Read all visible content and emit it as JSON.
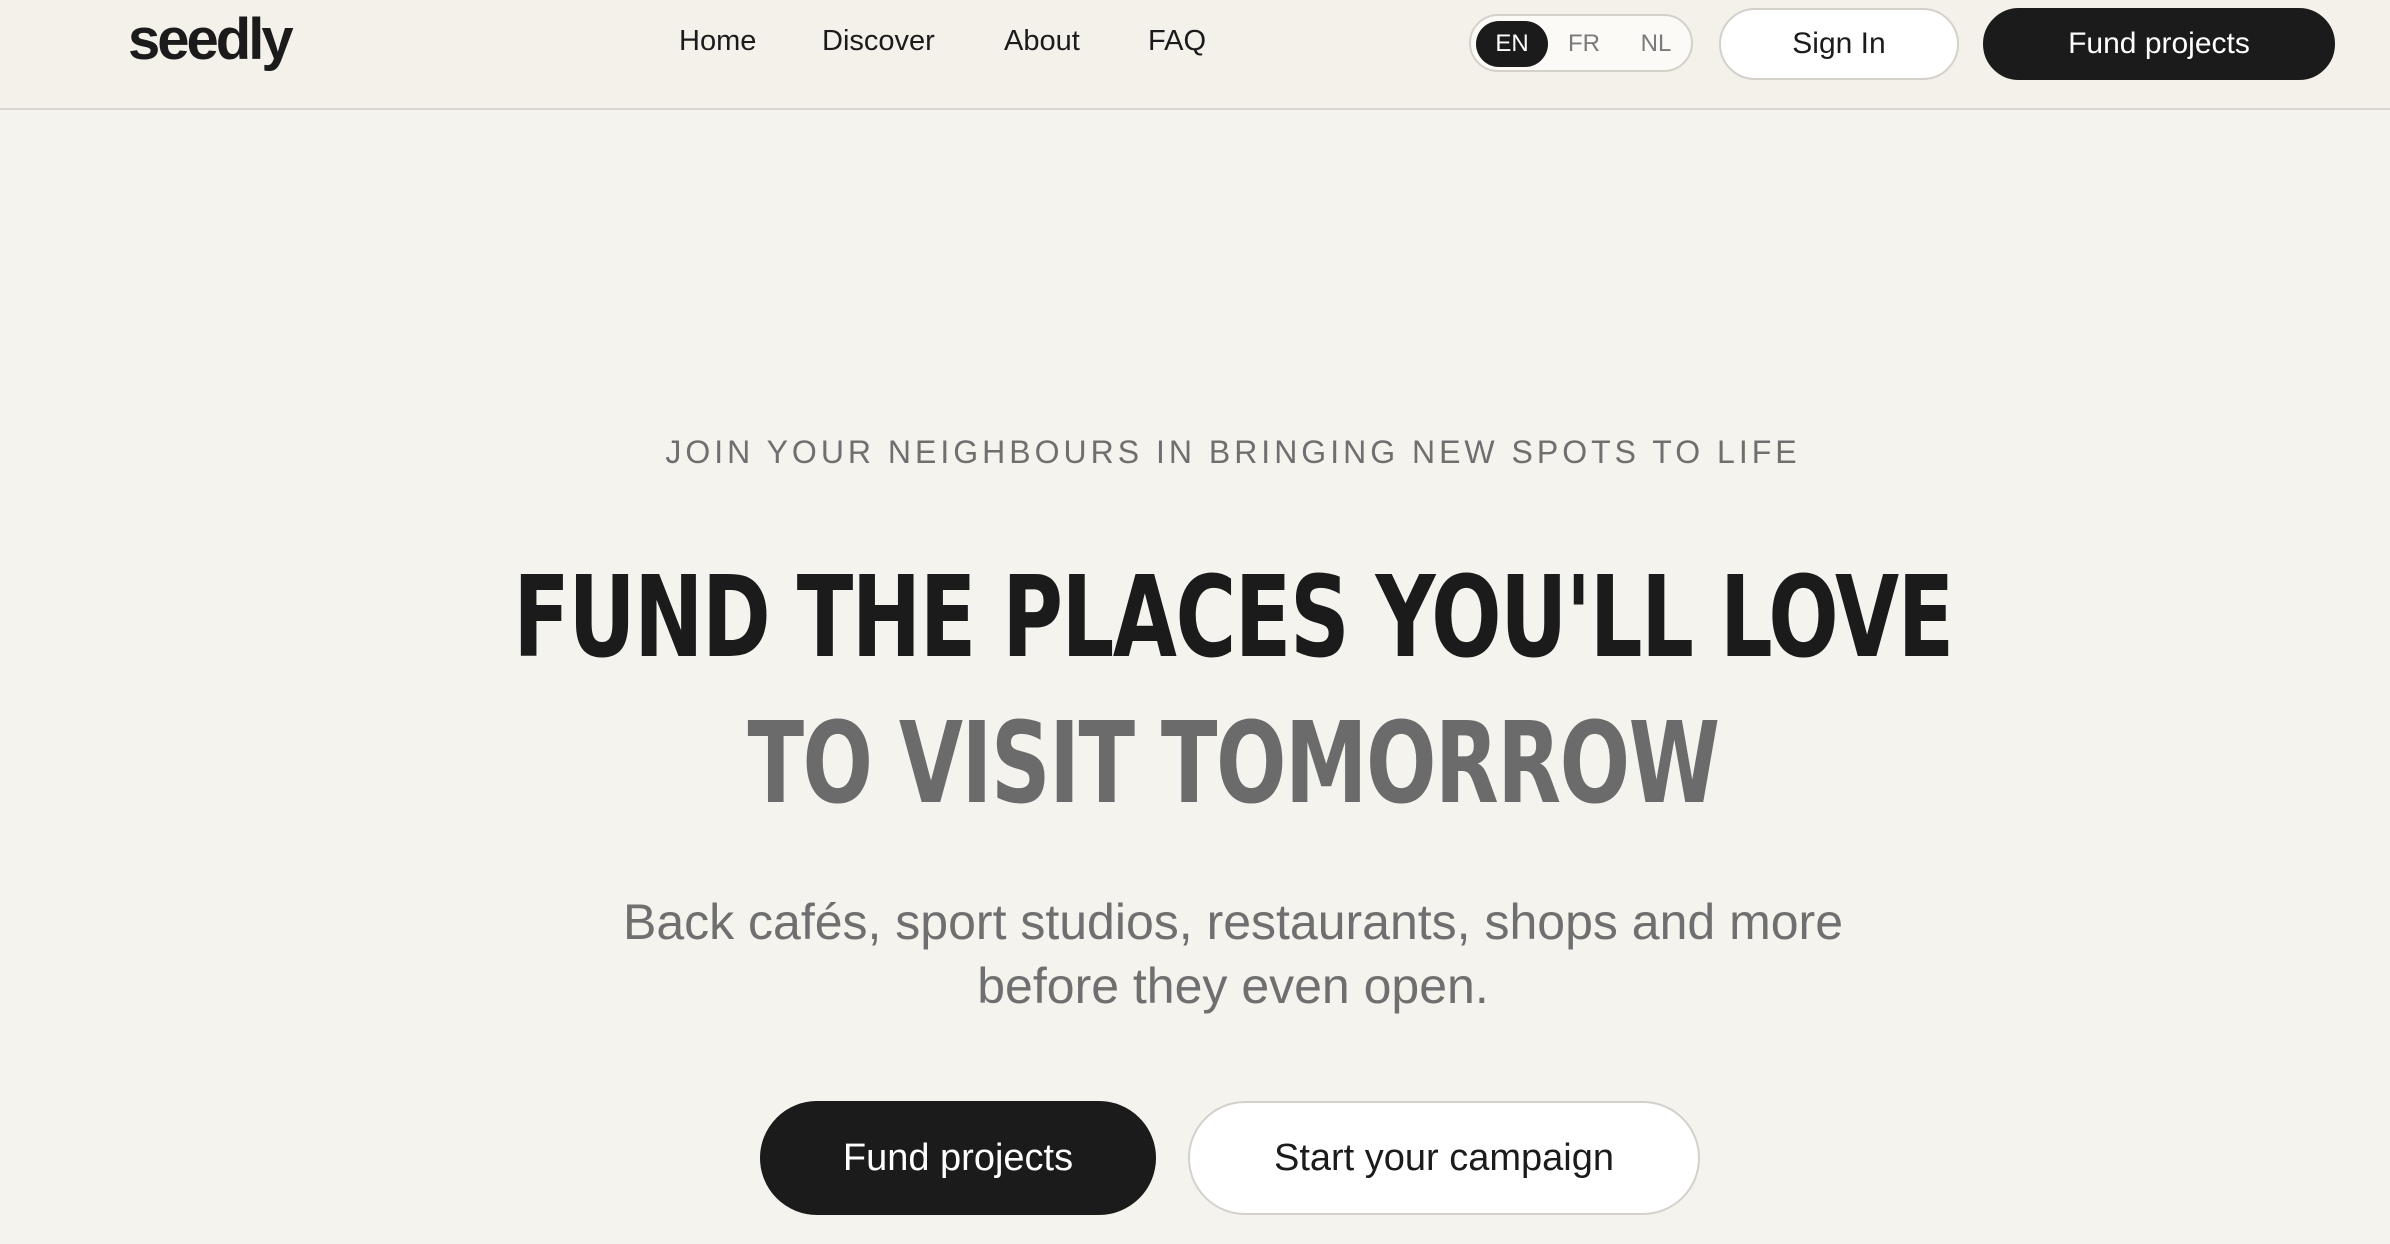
{
  "header": {
    "logo": "seedly",
    "nav": {
      "home": "Home",
      "discover": "Discover",
      "about": "About",
      "faq": "FAQ"
    },
    "languages": {
      "selected": "EN",
      "options": [
        "EN",
        "FR",
        "NL"
      ]
    },
    "sign_in_label": "Sign In",
    "fund_label": "Fund projects"
  },
  "hero": {
    "eyebrow": "JOIN YOUR NEIGHBOURS IN BRINGING NEW SPOTS TO LIFE",
    "headline_line1": "FUND THE PLACES YOU'LL LOVE",
    "headline_line2": "TO VISIT TOMORROW",
    "subtext_line1": "Back cafés, sport studios, restaurants, shops and more",
    "subtext_line2": "before they even open.",
    "primary_cta": "Fund projects",
    "secondary_cta": "Start your campaign"
  },
  "colors": {
    "background": "#f5f3ee",
    "dark": "#1b1b1b",
    "muted_text": "#6f6f6f",
    "border": "#d4d1cb"
  }
}
